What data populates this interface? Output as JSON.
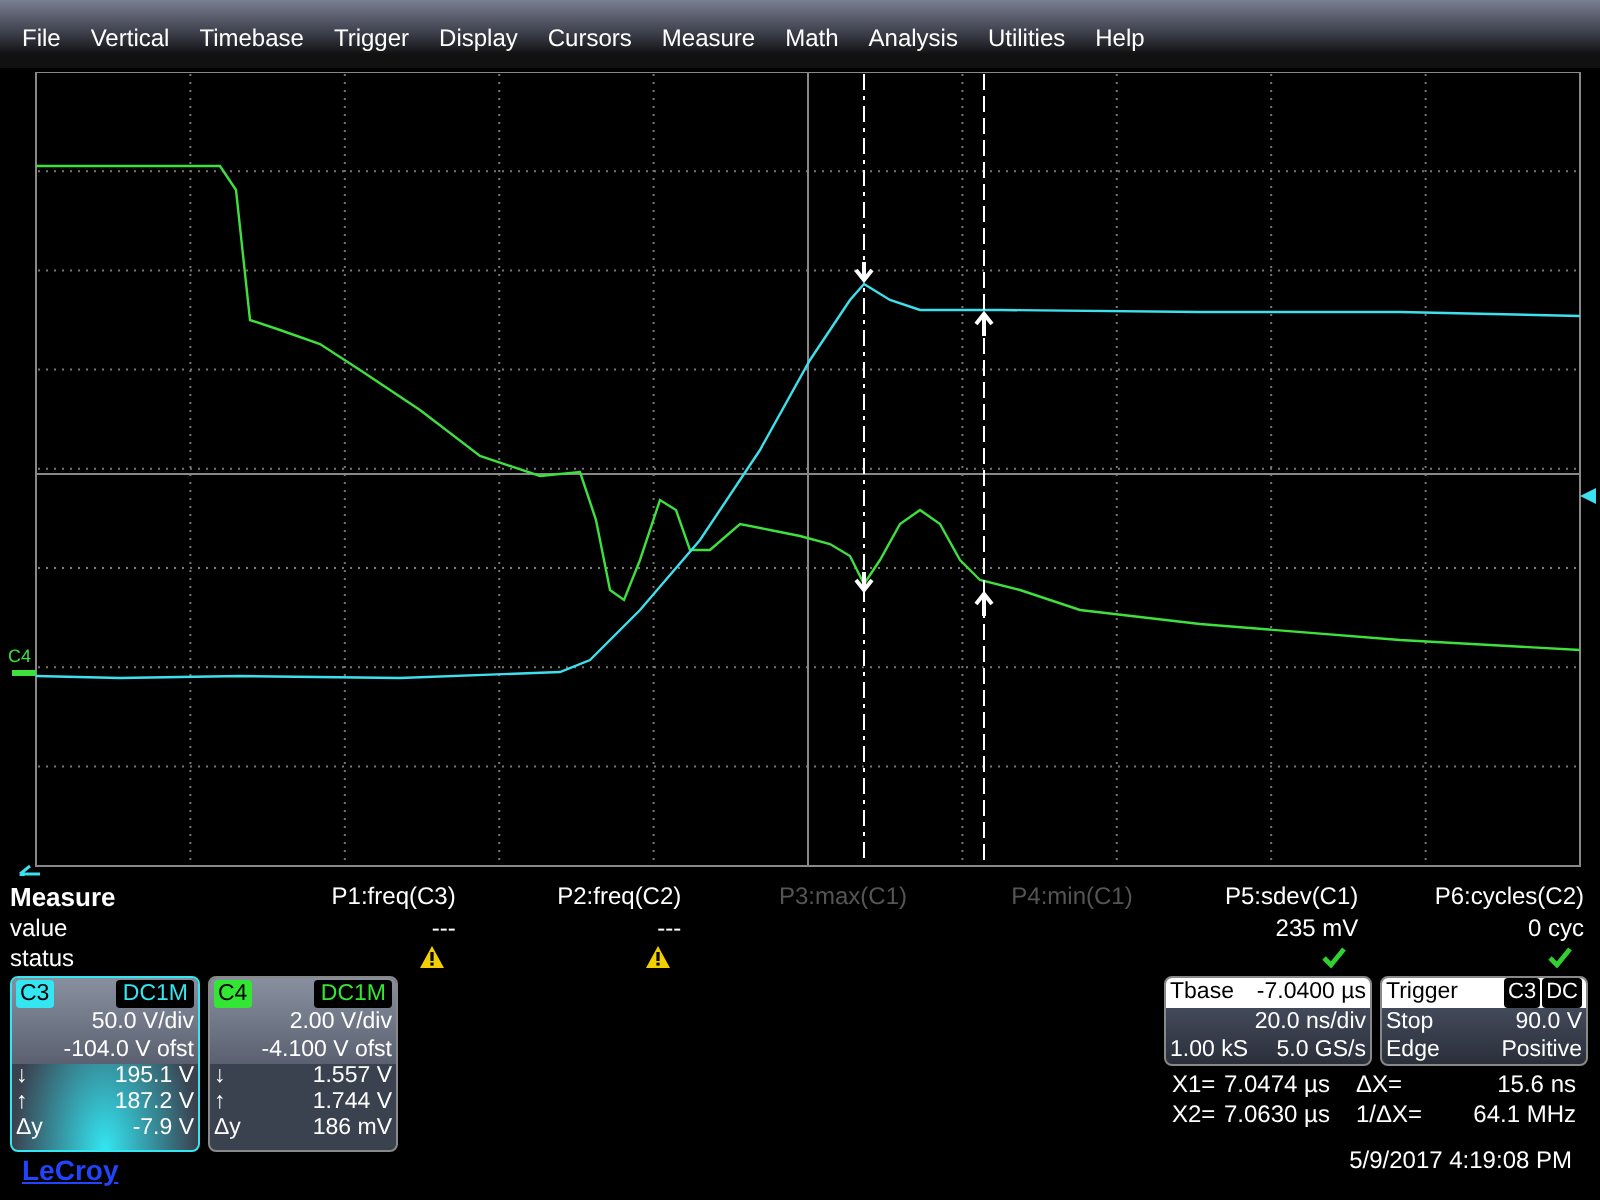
{
  "menu": [
    "File",
    "Vertical",
    "Timebase",
    "Trigger",
    "Display",
    "Cursors",
    "Measure",
    "Math",
    "Analysis",
    "Utilities",
    "Help"
  ],
  "plot": {
    "trace_label": "C4"
  },
  "measure": {
    "title": "Measure",
    "row_labels": [
      "value",
      "status"
    ],
    "params": [
      {
        "label": "P1:freq(C3)",
        "value": "---",
        "kind": "warning",
        "enabled": true
      },
      {
        "label": "P2:freq(C2)",
        "value": "---",
        "kind": "warning",
        "enabled": true
      },
      {
        "label": "P3:max(C1)",
        "enabled": false
      },
      {
        "label": "P4:min(C1)",
        "enabled": false
      },
      {
        "label": "P5:sdev(C1)",
        "value": "235 mV",
        "kind": "ok",
        "enabled": true
      },
      {
        "label": "P6:cycles(C2)",
        "value": "0 cyc",
        "kind": "ok",
        "enabled": true
      }
    ]
  },
  "channels": [
    {
      "name": "C3",
      "coupling": "DC1M",
      "color": "#33e6f2",
      "selected": true,
      "scale": "50.0 V/div",
      "offset": "-104.0 V ofst",
      "readings": [
        {
          "symbol": "↓",
          "value": "195.1 V"
        },
        {
          "symbol": "↑",
          "value": "187.2 V"
        },
        {
          "symbol": "Δy",
          "value": "-7.9 V"
        }
      ]
    },
    {
      "name": "C4",
      "coupling": "DC1M",
      "color": "#33e633",
      "selected": false,
      "scale": "2.00 V/div",
      "offset": "-4.100 V ofst",
      "readings": [
        {
          "symbol": "↓",
          "value": "1.557 V"
        },
        {
          "symbol": "↑",
          "value": "1.744 V"
        },
        {
          "symbol": "Δy",
          "value": "186 mV"
        }
      ]
    }
  ],
  "timebase": {
    "label": "Tbase",
    "delay": "-7.0400 µs",
    "scale": "20.0 ns/div",
    "samples": "1.00 kS",
    "rate": "5.0 GS/s"
  },
  "trigger": {
    "label": "Trigger",
    "source": "C3",
    "coupling": "DC",
    "mode": "Stop",
    "level": "90.0 V",
    "type": "Edge",
    "slope": "Positive"
  },
  "cursors": [
    {
      "label": "X1=",
      "value": "7.0474 µs",
      "delta_label": "ΔX=",
      "delta_value": "15.6 ns"
    },
    {
      "label": "X2=",
      "value": "7.0630 µs",
      "delta_label": "1/ΔX=",
      "delta_value": "64.1 MHz"
    }
  ],
  "datetime": "5/9/2017 4:19:08 PM",
  "logo": "LeCroy"
}
